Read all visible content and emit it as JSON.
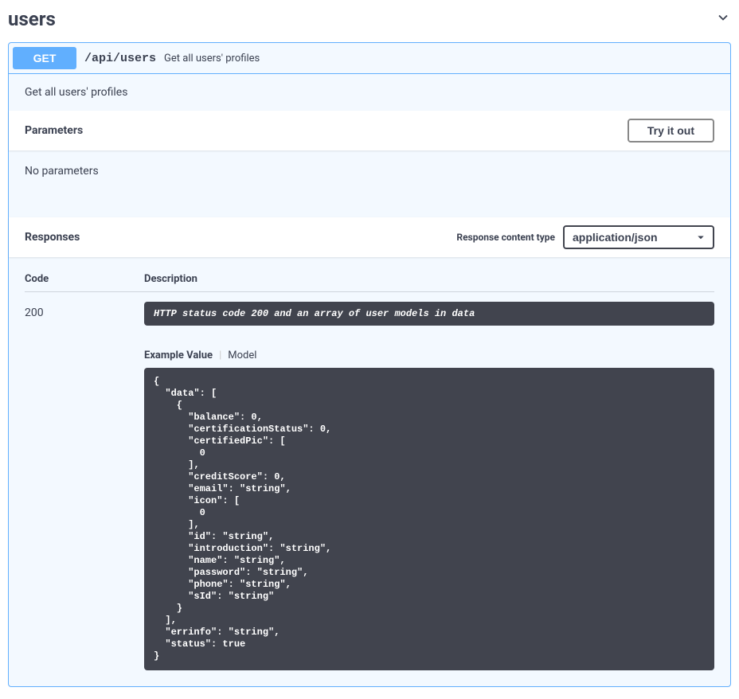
{
  "tag": {
    "name": "users"
  },
  "operation": {
    "method": "GET",
    "path": "/api/users",
    "summary": "Get all users' profiles",
    "description": "Get all users' profiles"
  },
  "parameters": {
    "heading": "Parameters",
    "try_it_out": "Try it out",
    "no_params": "No parameters"
  },
  "responses": {
    "heading": "Responses",
    "content_type_label": "Response content type",
    "content_type_value": "application/json",
    "columns": {
      "code": "Code",
      "description": "Description"
    },
    "items": [
      {
        "code": "200",
        "description": "HTTP status code 200 and an array of user models in data",
        "tabs": {
          "example": "Example Value",
          "model": "Model"
        },
        "example": "{\n  \"data\": [\n    {\n      \"balance\": 0,\n      \"certificationStatus\": 0,\n      \"certifiedPic\": [\n        0\n      ],\n      \"creditScore\": 0,\n      \"email\": \"string\",\n      \"icon\": [\n        0\n      ],\n      \"id\": \"string\",\n      \"introduction\": \"string\",\n      \"name\": \"string\",\n      \"password\": \"string\",\n      \"phone\": \"string\",\n      \"sId\": \"string\"\n    }\n  ],\n  \"errinfo\": \"string\",\n  \"status\": true\n}"
      }
    ]
  }
}
